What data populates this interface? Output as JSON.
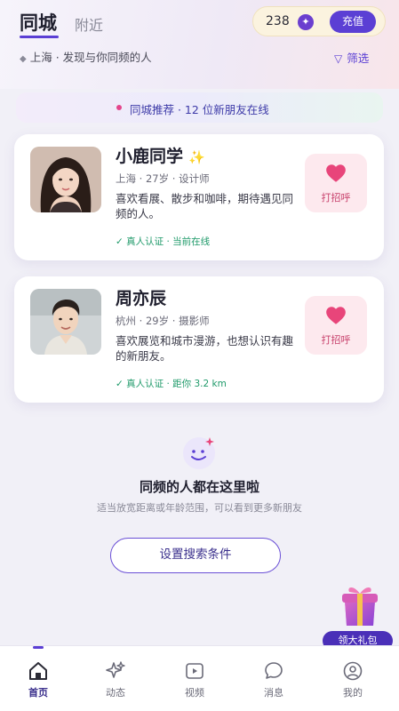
{
  "header": {
    "tab_active": "同城",
    "tab_inactive": "附近",
    "coins": "238",
    "recharge_label": "充值",
    "location_city": "上海",
    "location_slogan": "发现与你同频的人",
    "filter_label": "筛选"
  },
  "banner": {
    "text": "同城推荐 · 12 位新朋友在线"
  },
  "users": [
    {
      "name": "小鹿同学",
      "meta": "上海 · 27岁 · 设计师",
      "bio": "喜欢看展、散步和咖啡，期待遇见同频的人。",
      "verify": "✓ 真人认证 · 当前在线",
      "greet_label": "打招呼"
    },
    {
      "name": "周亦辰",
      "meta": "杭州 · 29岁 · 摄影师",
      "bio": "喜欢展览和城市漫游，也想认识有趣的新朋友。",
      "verify": "✓ 真人认证 · 距你 3.2 km",
      "greet_label": "打招呼"
    }
  ],
  "empty_state": {
    "title": "同频的人都在这里啦",
    "subtitle": "适当放宽距离或年龄范围，可以看到更多新朋友",
    "button_label": "设置搜索条件"
  },
  "gift": {
    "label": "领大礼包"
  },
  "tabbar": {
    "items": [
      {
        "label": "首页",
        "icon": "home-icon"
      },
      {
        "label": "动态",
        "icon": "sparkle-icon"
      },
      {
        "label": "视频",
        "icon": "video-icon"
      },
      {
        "label": "消息",
        "icon": "chat-bubble-icon"
      },
      {
        "label": "我的",
        "icon": "user-icon"
      }
    ],
    "active_index": 0
  },
  "colors": {
    "accent": "#5b3fd4",
    "heart": "#e8457a",
    "verify_green": "#1f9a6a"
  }
}
